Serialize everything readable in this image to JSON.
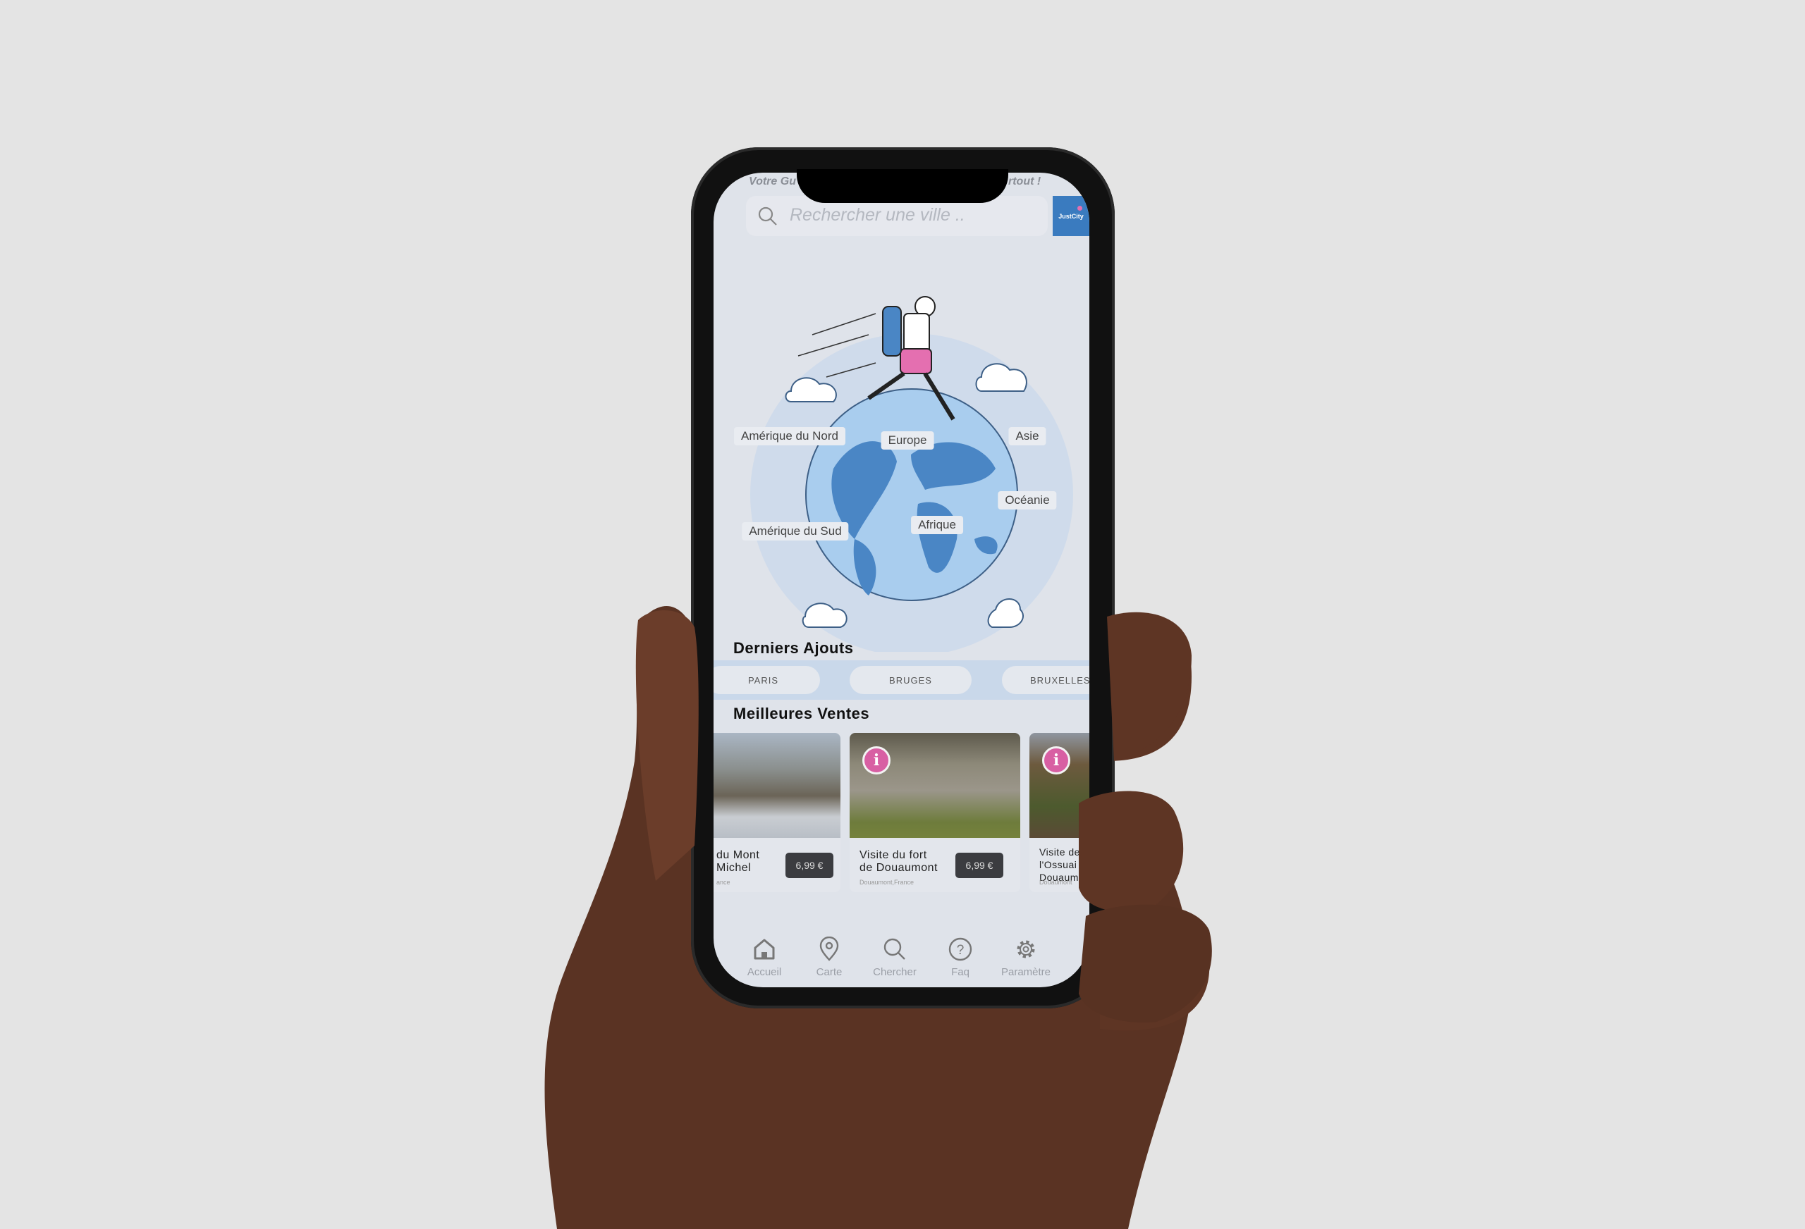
{
  "header": {
    "tagline_left": "Votre Gu",
    "tagline_right": "rtout !",
    "search_placeholder": "Rechercher une ville ..",
    "logo_text": "JustCity"
  },
  "map": {
    "labels": [
      "Amérique du Nord",
      "Europe",
      "Asie",
      "Océanie",
      "Afrique",
      "Amérique du Sud"
    ]
  },
  "latest": {
    "title": "Derniers Ajouts",
    "chips": [
      "PARIS",
      "BRUGES",
      "BRUXELLES"
    ]
  },
  "best": {
    "title": "Meilleures Ventes",
    "cards": [
      {
        "title": "du Mont\nMichel",
        "subtitle": "ance",
        "price": "6,99 €",
        "info": false
      },
      {
        "title": "Visite du fort\nde Douaumont",
        "subtitle": "Douaumont,France",
        "price": "6,99 €",
        "info": true
      },
      {
        "title": "Visite de\nl'Ossuai\nDouaum",
        "subtitle": "Douaumont",
        "info": true
      }
    ]
  },
  "nav": [
    {
      "label": "Accueil",
      "icon": "home-icon"
    },
    {
      "label": "Carte",
      "icon": "map-pin-icon"
    },
    {
      "label": "Chercher",
      "icon": "search-icon"
    },
    {
      "label": "Faq",
      "icon": "help-icon"
    },
    {
      "label": "Paramètre",
      "icon": "gear-icon"
    }
  ],
  "colors": {
    "accent": "#3a7bbf",
    "pink": "#d85fa3",
    "globe": "#a9cdee"
  }
}
